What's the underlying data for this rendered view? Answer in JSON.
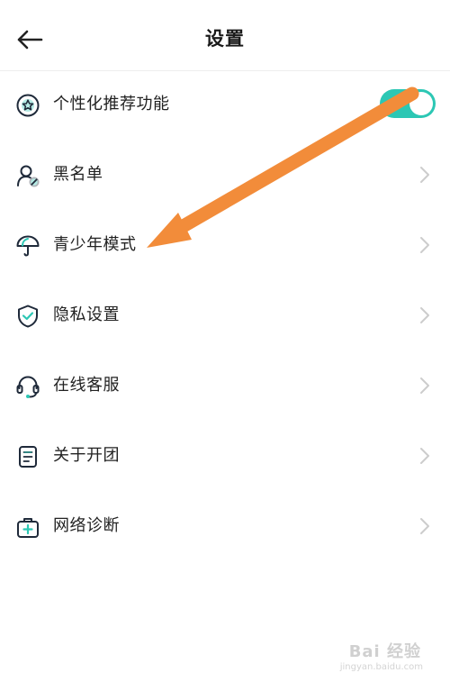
{
  "header": {
    "title": "设置"
  },
  "settings": {
    "personalized": {
      "label": "个性化推荐功能",
      "enabled": true
    },
    "items": [
      {
        "label": "黑名单",
        "icon": "blacklist-user-icon"
      },
      {
        "label": "青少年模式",
        "icon": "umbrella-icon"
      },
      {
        "label": "隐私设置",
        "icon": "shield-check-icon"
      },
      {
        "label": "在线客服",
        "icon": "headset-icon"
      },
      {
        "label": "关于开团",
        "icon": "document-icon"
      },
      {
        "label": "网络诊断",
        "icon": "medical-kit-icon"
      }
    ]
  },
  "annotation": {
    "color": "#f28c3a"
  },
  "colors": {
    "accent": "#2cc7b4",
    "icon_stroke": "#1f2a3a",
    "chevron": "#cccccc"
  },
  "watermark": {
    "brand": "Bai 经验",
    "url": "jingyan.baidu.com"
  }
}
